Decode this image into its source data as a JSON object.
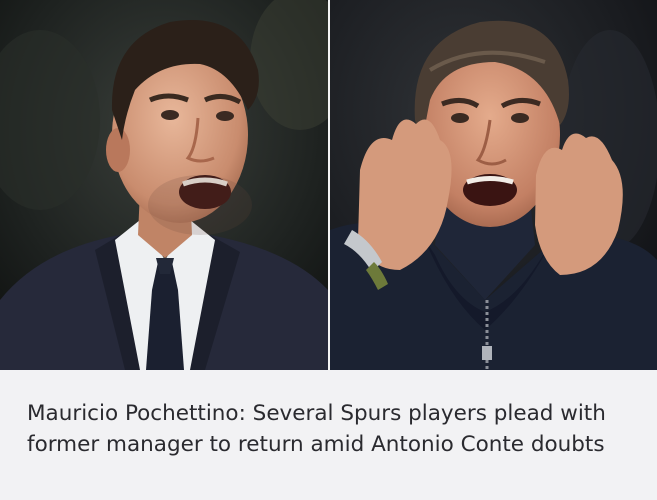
{
  "article": {
    "headline": "Mauricio Pochettino: Several Spurs players plead with former manager to return amid Antonio Conte doubts"
  },
  "images": {
    "left": {
      "subject": "Mauricio Pochettino"
    },
    "right": {
      "subject": "Antonio Conte"
    }
  },
  "colors": {
    "caption_background": "#f2f2f4",
    "headline_text": "#2a2a2f",
    "divider": "#f4f4f4"
  }
}
